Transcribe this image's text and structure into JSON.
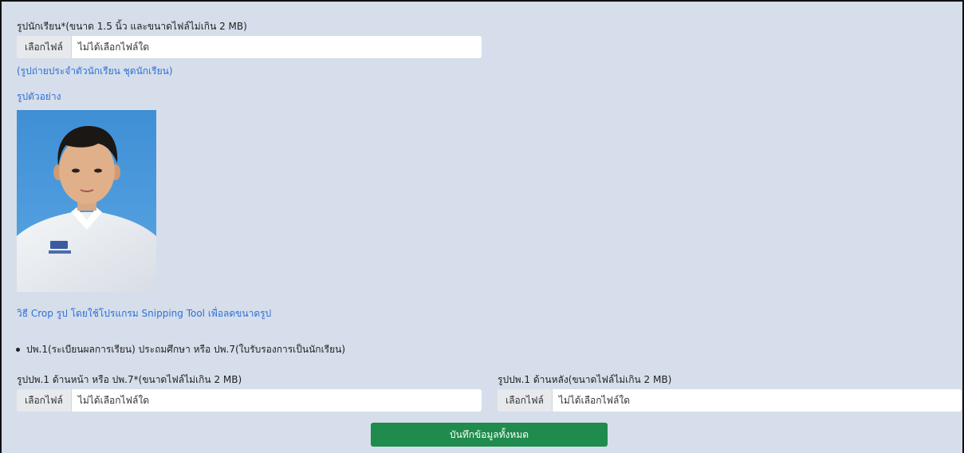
{
  "student_photo": {
    "label": "รูปนักเรียน*(ขนาด 1.5 นิ้ว และขนาดไฟล์ไม่เกิน 2 MB)",
    "file_button": "เลือกไฟล์",
    "file_status": "ไม่ได้เลือกไฟล์ใด",
    "hint": "(รูปถ่ายประจำตัวนักเรียน ชุดนักเรียน)",
    "sample_link": "รูปตัวอย่าง",
    "crop_link": "วิธี Crop รูป โดยใช้โปรแกรม Snipping Tool เพื่อลดขนาดรูป"
  },
  "document_section": {
    "bullet": "ปพ.1(ระเบียนผลการเรียน) ประถมศึกษา หรือ ปพ.7(ใบรับรองการเป็นนักเรียน)"
  },
  "front_doc": {
    "label": "รูปปพ.1 ด้านหน้า หรือ ปพ.7*(ขนาดไฟล์ไม่เกิน 2 MB)",
    "file_button": "เลือกไฟล์",
    "file_status": "ไม่ได้เลือกไฟล์ใด"
  },
  "back_doc": {
    "label": "รูปปพ.1 ด้านหลัง(ขนาดไฟล์ไม่เกิน 2 MB)",
    "file_button": "เลือกไฟล์",
    "file_status": "ไม่ได้เลือกไฟล์ใด"
  },
  "actions": {
    "save_all": "บันทึกข้อมูลทั้งหมด"
  }
}
